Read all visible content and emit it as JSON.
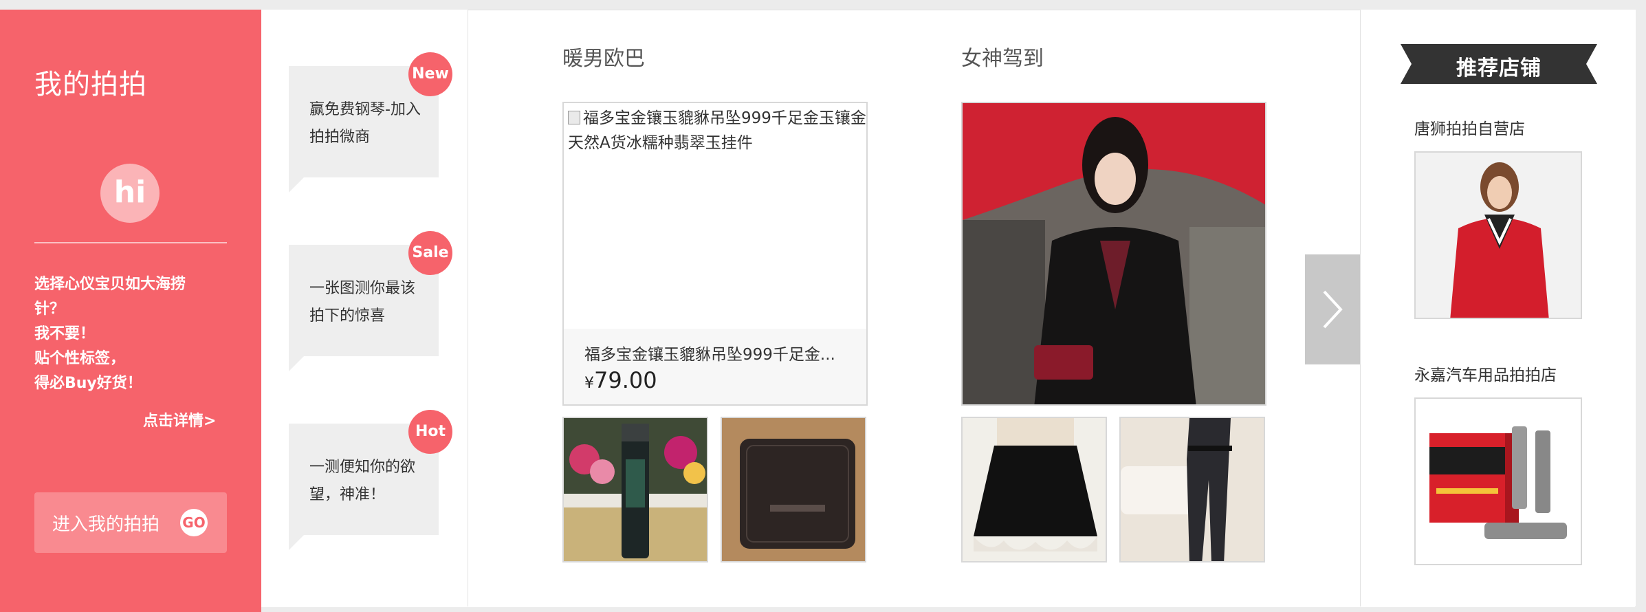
{
  "my_paipai": {
    "title": "我的拍拍",
    "hi": "hi",
    "description_lines": [
      "选择心仪宝贝如大海捞",
      "针？",
      "我不要！",
      "贴个性标签，",
      "得必Buy好货！"
    ],
    "details_link": "点击详情>",
    "enter_button": "进入我的拍拍",
    "go_label": "GO"
  },
  "promos": [
    {
      "badge": "New",
      "text": "赢免费钢琴-加入拍拍微商"
    },
    {
      "badge": "Sale",
      "text": "一张图测你最该拍下的惊喜"
    },
    {
      "badge": "Hot",
      "text": "一测便知你的欲望，神准！"
    }
  ],
  "sections": [
    {
      "title": "暖男欧巴",
      "featured": {
        "alt_text": "福多宝金镶玉貔貅吊坠999千足金玉镶金天然A货冰糯种翡翠玉挂件",
        "name": "福多宝金镶玉貔貅吊坠999千足金...",
        "currency": "¥",
        "price": "79.00"
      },
      "thumbs": [
        "men-toner-bottle",
        "leather-wallet"
      ]
    },
    {
      "title": "女神驾到",
      "featured": {
        "image": "woman-in-black-blazer"
      },
      "thumbs": [
        "lace-black-skirt",
        "skinny-pants"
      ]
    }
  ],
  "recommended": {
    "title": "推荐店铺",
    "shops": [
      {
        "name": "唐狮拍拍自营店",
        "image": "red-jacket-model"
      },
      {
        "name": "永嘉汽车用品拍拍店",
        "image": "fuel-additive-box"
      }
    ]
  },
  "colors": {
    "accent": "#f6636b",
    "ribbon": "#333333"
  }
}
